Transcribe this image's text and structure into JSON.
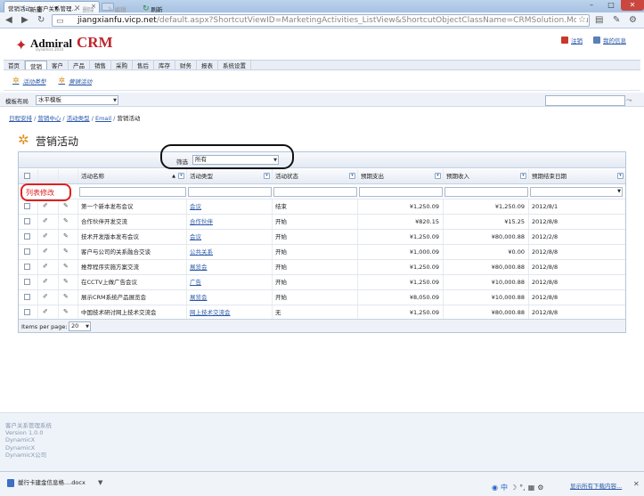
{
  "browser": {
    "tab_title": "营销活动 - 客户关系管理...",
    "url_domain": "jiangxianfu.vicp.net",
    "url_path": "/default.aspx?ShortcutViewID=MarketingActivities_ListView&ShortcutObjectClassName=CRMSolution.Module.Mark"
  },
  "header": {
    "logo_word": "Admiral",
    "logo_sub": "Dynamics 2010",
    "logo_crm": "CRM",
    "link_logout": "注销",
    "link_myinfo": "我的信息"
  },
  "menu": {
    "items": [
      "首页",
      "营销",
      "客户",
      "产品",
      "销售",
      "采购",
      "售后",
      "库存",
      "财务",
      "报表",
      "系统设置"
    ],
    "active_index": 1
  },
  "submenu": {
    "items": [
      "活动类型",
      "营销活动"
    ]
  },
  "modebar": {
    "label": "模板布局",
    "value": "水平模板"
  },
  "breadcrumb": {
    "items": [
      "日程安排",
      "营销中心",
      "活动类型",
      "Email"
    ],
    "current": "营销活动"
  },
  "page": {
    "title": "营销活动"
  },
  "toolbar": {
    "new": "新建",
    "delete": "删除",
    "edit": "编辑",
    "refresh": "刷新",
    "filter_label": "筛选",
    "filter_value": "所有"
  },
  "annotation": {
    "list_modify": "列表修改"
  },
  "grid": {
    "columns": [
      "活动名称",
      "活动类型",
      "活动状态",
      "预期支出",
      "预期收入",
      "预期结束日期"
    ],
    "rows": [
      [
        "第一个新本发布会议",
        "会议",
        "结束",
        "¥1,250.09",
        "¥1,250.09",
        "2012/8/1"
      ],
      [
        "合作伙伴开发交流",
        "合作伙伴",
        "开始",
        "¥820.15",
        "¥15.25",
        "2012/8/8"
      ],
      [
        "技术开发版本发布会议",
        "会议",
        "开始",
        "¥1,250.09",
        "¥80,000.88",
        "2012/2/8"
      ],
      [
        "客户与公司的关系融合交谈",
        "公共关系",
        "开始",
        "¥1,000.09",
        "¥0.00",
        "2012/8/8"
      ],
      [
        "推荐程序实施方案交流",
        "展览会",
        "开始",
        "¥1,250.09",
        "¥80,000.88",
        "2012/8/8"
      ],
      [
        "在CCTV上做广告会议",
        "广告",
        "开始",
        "¥1,250.09",
        "¥10,000.88",
        "2012/8/8"
      ],
      [
        "展示CRM系统产品展览会",
        "展览会",
        "开始",
        "¥8,050.09",
        "¥10,000.88",
        "2012/8/8"
      ],
      [
        "中国技术研讨网上技术交流会",
        "网上技术交流会",
        "无",
        "¥1,250.09",
        "¥80,000.88",
        "2012/8/8"
      ]
    ]
  },
  "pager": {
    "label": "Items per page:",
    "value": "20"
  },
  "footer": {
    "lines": [
      "客户关系管理系统",
      "Version 1.0.0",
      "DynamicX",
      "DynamicX",
      "DynamicX公司"
    ]
  },
  "downloads": {
    "item": "援行卡建金信息格....docx",
    "show_all": "显示所有下载内容..."
  }
}
